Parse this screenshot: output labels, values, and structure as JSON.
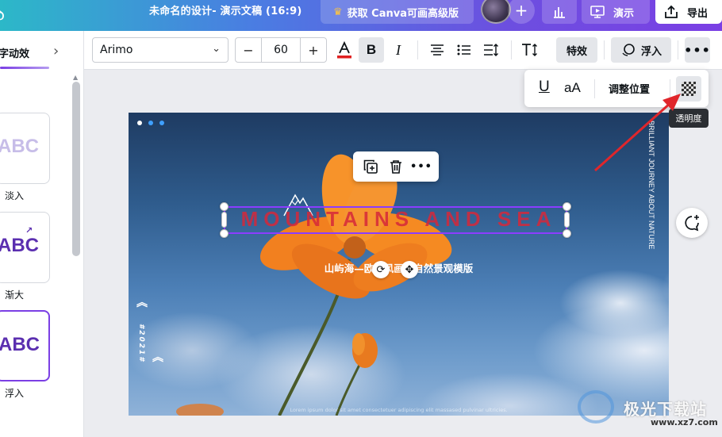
{
  "topbar": {
    "logo": "ꝺ",
    "title": "未命名的设计- 演示文稿 (16:9)",
    "upgrade_label": "获取 Canva可画高级版",
    "add_label": "+",
    "present_label": "演示",
    "export_label": "导出"
  },
  "left_panel": {
    "header": "字动效",
    "items": [
      {
        "preview": "ABC",
        "label": "淡入"
      },
      {
        "preview": "ABC",
        "label": "渐大"
      },
      {
        "preview": "ABC",
        "label": "浮入"
      }
    ]
  },
  "toolbar": {
    "font": "Arimo",
    "font_size": "60",
    "minus": "−",
    "plus": "+",
    "bold": "B",
    "italic": "I",
    "effects_label": "特效",
    "float_label": "浮入",
    "more": "•••"
  },
  "popup": {
    "underline": "U",
    "case": "aA",
    "position_label": "调整位置",
    "tooltip": "透明度"
  },
  "slide": {
    "vertical_text": "BRILLIANT JOURNEY ABOUT NATURE",
    "title": "MOUNTAINS AND SEA",
    "subtitle": "山屿海—欧美风画册自然景观模版",
    "year": "#2021#",
    "footer": "Lorem ipsum dolor sit amet consectetuer adipiscing elit massased pulvinar ultricies."
  },
  "context_menu": {
    "more": "•••"
  },
  "watermark": {
    "text": "极光下载站",
    "url": "www.xz7.com"
  },
  "colors": {
    "accent": "#8b3dff",
    "title_red": "#d6283a",
    "arrow_red": "#e0262b"
  }
}
